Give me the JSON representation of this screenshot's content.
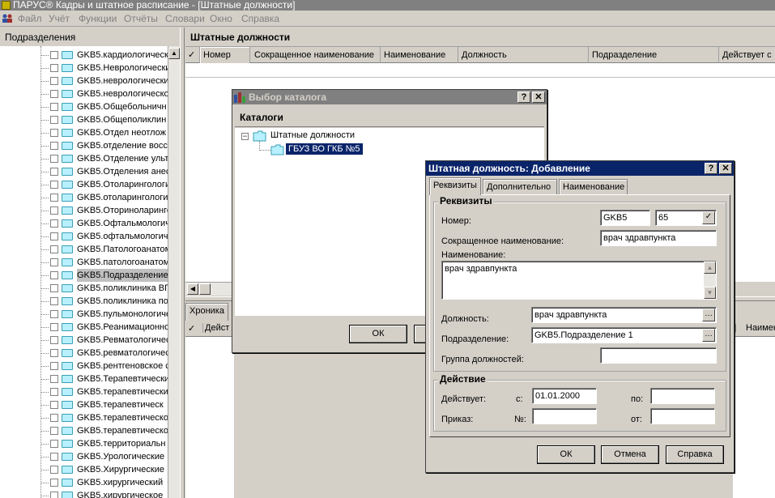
{
  "app": {
    "title": "ПАРУС® Кадры и штатное расписание - [Штатные должности]",
    "menu": [
      "Файл",
      "Учёт",
      "Функции",
      "Отчёты",
      "Словари",
      "Окно",
      "Справка"
    ]
  },
  "left_panel": {
    "header": "Подразделения",
    "tree_items": [
      "GKB5.кардиологическ",
      "GKB5.Неврологически",
      "GKB5.неврологически",
      "GKB5.неврологическо",
      "GKB5.Общебольничн",
      "GKB5.Общеполиклин",
      "GKB5.Отдел неотлож",
      "GKB5.отделение восс",
      "GKB5.Отделение ульт",
      "GKB5.Отделения анес",
      "GKB5.Отоларингологи",
      "GKB5.отоларингологи",
      "GKB5.Оториноларинго",
      "GKB5.Офтальмологич",
      "GKB5.офтальмологич",
      "GKB5.Патологоанатом",
      "GKB5.патологоанатом",
      "GKB5.Подразделение",
      "GKB5.поликлиника ВП",
      "GKB5.поликлиника по",
      "GKB5.пульмонологиче",
      "GKB5.Реанимационно-",
      "GKB5.Ревматологичес",
      "GKB5.ревматологичес",
      "GKB5.рентгеновское с",
      "GKB5.Терапевтически",
      "GKB5.терапевтически",
      "GKB5.терапевтическ",
      "GKB5.терапевтическо",
      "GKB5.терапевтическо",
      "GKB5.территориальн",
      "GKB5.Урологические",
      "GKB5.Хирургические",
      "GKB5.хирургический",
      "GKB5.хирургическое"
    ],
    "selected_index": 17
  },
  "main_panel": {
    "header": "Штатные должности",
    "columns": [
      "Номер",
      "Сокращенное наименование",
      "Наименование",
      "Должность",
      "Подразделение",
      "Действует с"
    ],
    "check_mark": "✓"
  },
  "lower_panel": {
    "tab": "Хроника",
    "col_left": "Дейст",
    "col_right": "Наимен"
  },
  "catalog_dialog": {
    "title": "Выбор каталога",
    "help": "?",
    "close": "✕",
    "header": "Каталоги",
    "root_expander": "−",
    "root": "Штатные должности",
    "child": "ГБУЗ ВО ГКБ №5",
    "ok": "ОК"
  },
  "add_dialog": {
    "title": "Штатная должность: Добавление",
    "help": "?",
    "close": "✕",
    "tabs": [
      "Реквизиты",
      "Дополнительно",
      "Наименование"
    ],
    "group_requisites": "Реквизиты",
    "label_number": "Номер:",
    "number_prefix": "GKB5",
    "number_value": "65",
    "label_short": "Сокращенное наименование:",
    "short_value": "врач здравпункта",
    "label_name": "Наименование:",
    "name_value": "врач здравпункта",
    "label_position": "Должность:",
    "position_value": "врач здравпункта",
    "label_division": "Подразделение:",
    "division_value": "GKB5.Подразделение 1",
    "label_group": "Группа должностей:",
    "group_value": "",
    "group_action": "Действие",
    "label_active": "Действует:",
    "label_from": "с:",
    "from_value": "01.01.2000",
    "label_to": "по:",
    "to_value": "",
    "label_order": "Приказ:",
    "label_no": "№:",
    "order_no": "",
    "label_date": "от:",
    "order_date": "",
    "ellipsis": "…",
    "check": "✓",
    "btn_ok": "ОК",
    "btn_cancel": "Отмена",
    "btn_help": "Справка"
  }
}
